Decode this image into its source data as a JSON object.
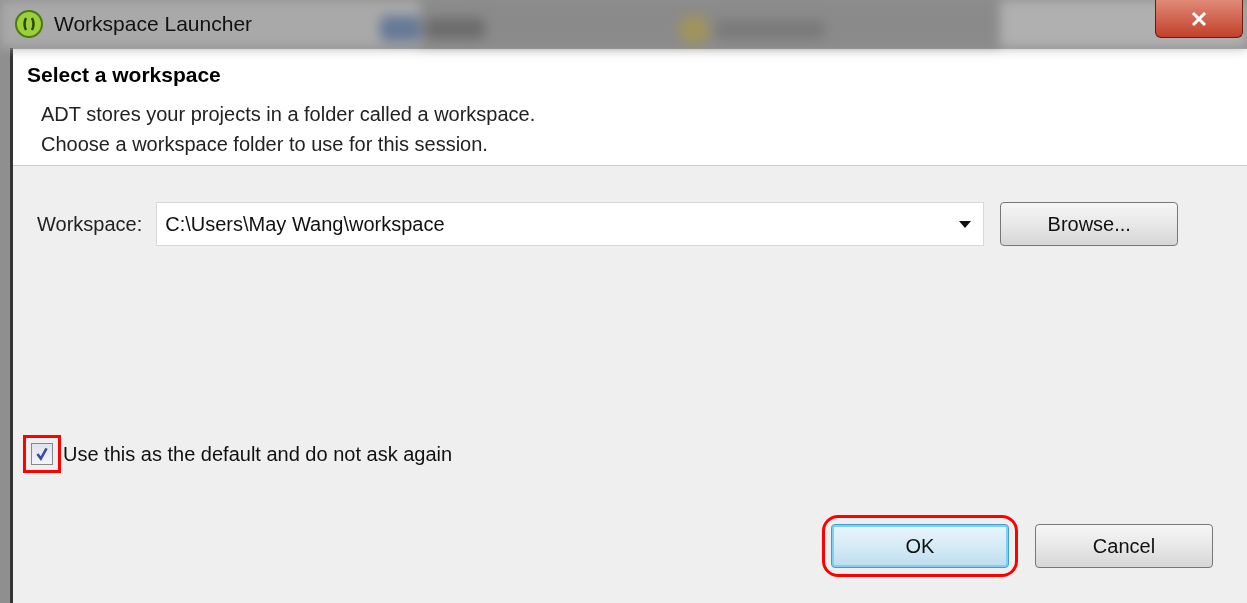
{
  "window": {
    "title": "Workspace Launcher"
  },
  "header": {
    "title": "Select a workspace",
    "lines": [
      "ADT stores your projects in a folder called a workspace.",
      "Choose a workspace folder to use for this session."
    ]
  },
  "workspace": {
    "label": "Workspace:",
    "value": "C:\\Users\\May Wang\\workspace",
    "browse": "Browse..."
  },
  "default_checkbox": {
    "label": "Use this as the default and do not ask again",
    "checked": true,
    "highlighted": true
  },
  "buttons": [
    {
      "label": "OK",
      "default": true,
      "highlighted": true
    },
    {
      "label": "Cancel",
      "default": false,
      "highlighted": false
    }
  ]
}
